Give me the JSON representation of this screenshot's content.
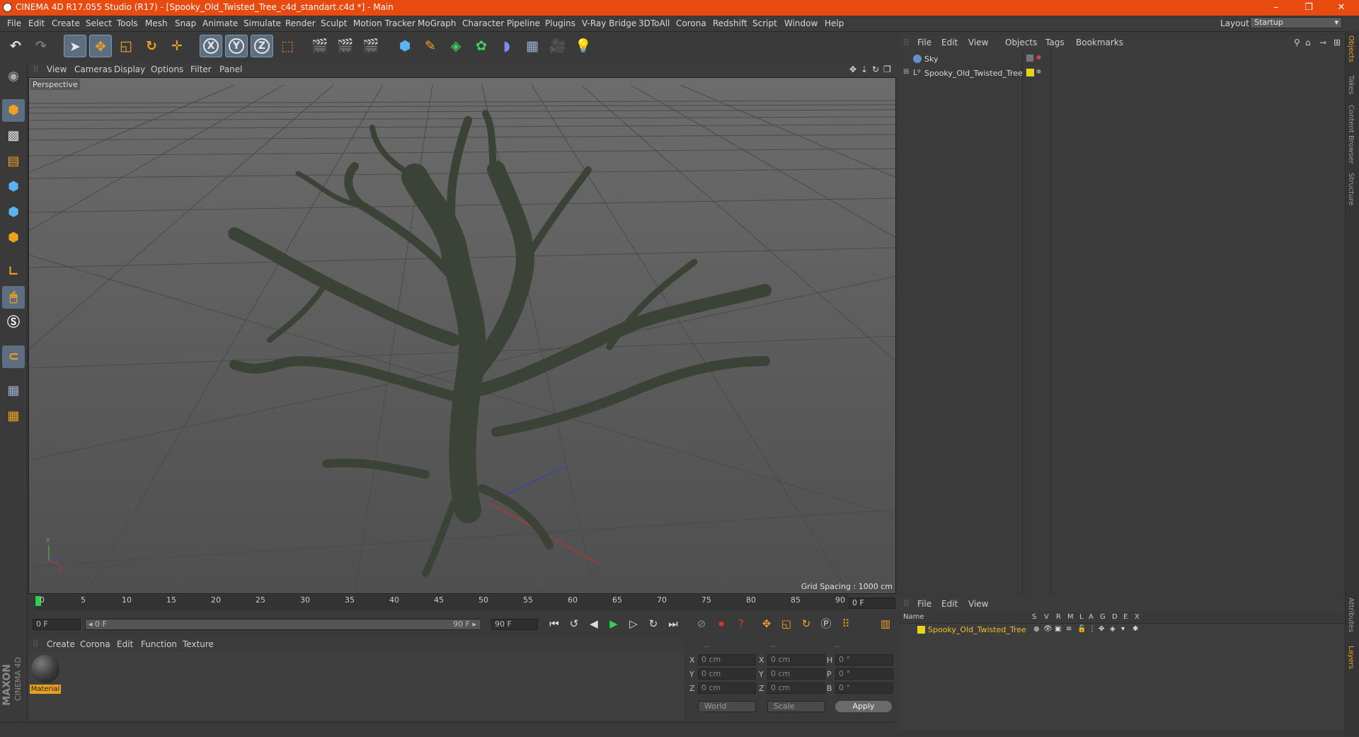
{
  "window": {
    "title": "CINEMA 4D R17.055 Studio (R17) - [Spooky_Old_Twisted_Tree_c4d_standart.c4d *] - Main",
    "minimize": "–",
    "restore": "❐",
    "close": "✕"
  },
  "menubar": {
    "items": [
      "File",
      "Edit",
      "Create",
      "Select",
      "Tools",
      "Mesh",
      "Snap",
      "Animate",
      "Simulate",
      "Render",
      "Sculpt",
      "Motion Tracker",
      "MoGraph",
      "Character",
      "Pipeline",
      "Plugins",
      "V-Ray Bridge",
      "3DToAll",
      "Corona",
      "Redshift",
      "Script",
      "Window",
      "Help"
    ],
    "layout_label": "Layout:",
    "layout_value": "Startup"
  },
  "viewport": {
    "menu": [
      "View",
      "Cameras",
      "Display",
      "Options",
      "Filter",
      "Panel"
    ],
    "label": "Perspective",
    "grid_spacing": "Grid Spacing : 1000 cm"
  },
  "timeline": {
    "ticks": [
      "0",
      "5",
      "10",
      "15",
      "20",
      "25",
      "30",
      "35",
      "40",
      "45",
      "50",
      "55",
      "60",
      "65",
      "70",
      "75",
      "80",
      "85",
      "90"
    ],
    "current_frame": "0 F",
    "start_field": "0 F",
    "range_start": "◂ 0 F",
    "range_end": "90 F ▸",
    "end_field": "90 F"
  },
  "materials": {
    "menu": [
      "Create",
      "Corona",
      "Edit",
      "Function",
      "Texture"
    ],
    "items": [
      {
        "name": "Material"
      }
    ]
  },
  "coordinates": {
    "header": [
      "--",
      "--",
      "--"
    ],
    "rows": [
      {
        "a": "X",
        "av": "0 cm",
        "b": "X",
        "bv": "0 cm",
        "c": "H",
        "cv": "0 °"
      },
      {
        "a": "Y",
        "av": "0 cm",
        "b": "Y",
        "bv": "0 cm",
        "c": "P",
        "cv": "0 °"
      },
      {
        "a": "Z",
        "av": "0 cm",
        "b": "Z",
        "bv": "0 cm",
        "c": "B",
        "cv": "0 °"
      }
    ],
    "mode1": "World",
    "mode2": "Scale",
    "apply": "Apply"
  },
  "objects": {
    "menu": [
      "File",
      "Edit",
      "View",
      "Objects",
      "Tags",
      "Bookmarks"
    ],
    "items": [
      {
        "name": "Sky"
      },
      {
        "name": "Spooky_Old_Twisted_Tree"
      }
    ]
  },
  "layers": {
    "menu": [
      "File",
      "Edit",
      "View"
    ],
    "columns": [
      "Name",
      "S",
      "V",
      "R",
      "M",
      "L",
      "A",
      "G",
      "D",
      "E",
      "X"
    ],
    "items": [
      {
        "name": "Spooky_Old_Twisted_Tree",
        "color": "#e8d21a"
      }
    ]
  },
  "side_tabs": [
    "Objects",
    "Takes",
    "Content Browser",
    "Structure",
    "Attributes",
    "Layers"
  ],
  "brand": {
    "maxon": "MAXON",
    "product": "CINEMA 4D"
  },
  "colors": {
    "accent": "#e84a10",
    "layer_yellow": "#e8d21a",
    "highlight_text": "#f0c020"
  }
}
